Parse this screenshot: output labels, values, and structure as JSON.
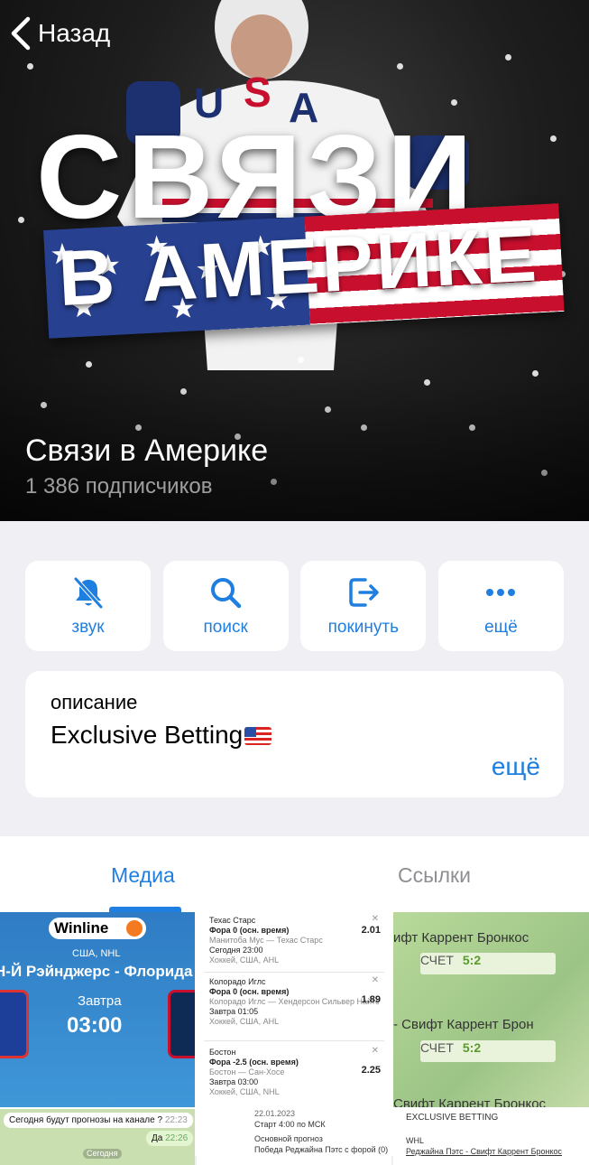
{
  "nav": {
    "back_label": "Назад"
  },
  "header": {
    "cover_title_line1": "СВЯЗИ",
    "cover_title_line2": "В АМЕРИКЕ",
    "channel_name": "Связи в Америке",
    "subscribers": "1 386 подписчиков"
  },
  "actions": [
    {
      "label": "звук",
      "icon": "bell-slash-icon"
    },
    {
      "label": "поиск",
      "icon": "search-icon"
    },
    {
      "label": "покинуть",
      "icon": "leave-icon"
    },
    {
      "label": "ещё",
      "icon": "more-icon"
    }
  ],
  "description": {
    "label": "описание",
    "text": "Exclusive Betting",
    "more": "ещё"
  },
  "tabs": {
    "media": "Медиа",
    "links": "Ссылки"
  },
  "media": {
    "winline": {
      "brand": "Winline",
      "league": "США, NHL",
      "match": "Н-Й Рэйнджерс - Флорида",
      "when": "Завтра",
      "time": "03:00"
    },
    "bets": [
      {
        "teams": "Техас Старс",
        "market": "Фора 0 (осн. время)",
        "detail": "Манитоба Мус — Техас Старс",
        "when": "Сегодня 23:00",
        "league": "Хоккей, США, AHL",
        "odd": "2.01"
      },
      {
        "teams": "Колорадо Иглс",
        "market": "Фора 0 (осн. время)",
        "detail": "Колорадо Иглс — Хендерсон Сильвер Найтс",
        "when": "Завтра 01:05",
        "league": "Хоккей, США, AHL",
        "odd": "1.89"
      },
      {
        "teams": "Бостон",
        "market": "Фора -2.5 (осн. время)",
        "detail": "Бостон — Сан-Хосе",
        "when": "Завтра 03:00",
        "league": "Хоккей, США, NHL",
        "odd": "2.25"
      }
    ],
    "scores": {
      "title1": "ифт Каррент Бронкос",
      "score_label1": "СЧЕТ",
      "score_value1": "5:2",
      "title2": "- Свифт Каррент Брон",
      "score_label2": "СЧЕТ",
      "score_value2": "5:2",
      "title3": "Свифт Каррент Бронкос"
    },
    "chat": {
      "msg1": "Сегодня будут прогнозы на канале ?",
      "msg1_time": "22:23",
      "msg2": "Да",
      "msg2_time": "22:26",
      "msg3": "Сегодня"
    },
    "post": {
      "date": "22.01.2023",
      "start": "Старт 4:00 по МСК",
      "main": "Основной прогноз",
      "pick": "Победа Реджайна Пэтс с форой (0)"
    },
    "post2": {
      "title": "EXCLUSIVE BETTING",
      "league": "WHL",
      "match": "Реджайна Пэтс - Свифт Каррент Бронкос"
    }
  },
  "colors": {
    "accent": "#1f7fe0",
    "background": "#efeff4",
    "flag_blue": "#27408f",
    "flag_red": "#c8102e"
  }
}
